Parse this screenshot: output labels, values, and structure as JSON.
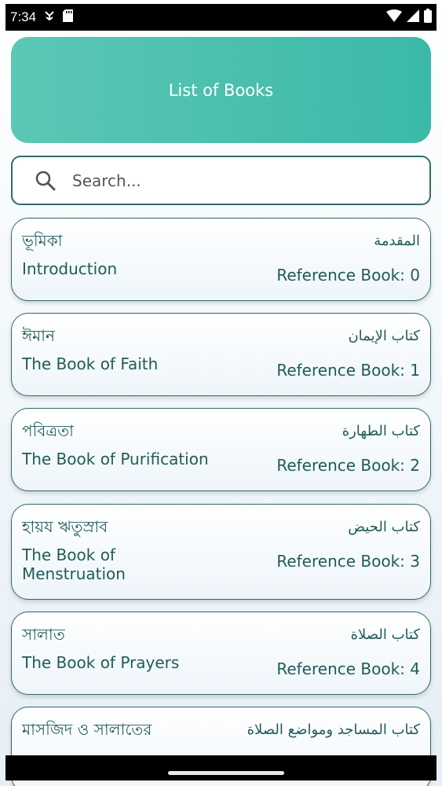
{
  "status_bar": {
    "time": "7:34",
    "left_icons": [
      "usb-debug-icon",
      "sd-card-icon"
    ],
    "right_icons": [
      "wifi-icon",
      "signal-icon",
      "battery-icon"
    ]
  },
  "header": {
    "title": "List of Books"
  },
  "search": {
    "placeholder": "Search...",
    "value": ""
  },
  "books": [
    {
      "bengali": "ভূমিকা",
      "english": "Introduction",
      "arabic": "المقدمة",
      "reference": "Reference Book: 0"
    },
    {
      "bengali": "ঈমান",
      "english": "The Book of Faith",
      "arabic": "كتاب الإيمان",
      "reference": "Reference Book: 1"
    },
    {
      "bengali": "পবিত্রতা",
      "english": "The Book of Purification",
      "arabic": "كتاب الطهارة",
      "reference": "Reference Book: 2"
    },
    {
      "bengali": "হায়য ঋতুস্রাব",
      "english": "The Book of Menstruation",
      "arabic": "كتاب الحيض",
      "reference": "Reference Book: 3"
    },
    {
      "bengali": "সালাত",
      "english": "The Book of Prayers",
      "arabic": "كتاب الصلاة",
      "reference": "Reference Book: 4"
    },
    {
      "bengali": "মাসজিদ ও সালাতের",
      "english": "",
      "arabic": "كتاب المساجد ومواضع الصلاة",
      "reference": ""
    }
  ],
  "colors": {
    "header_bg": "#3bb9a8",
    "text": "#1f5c58",
    "border": "#2e6a66"
  }
}
